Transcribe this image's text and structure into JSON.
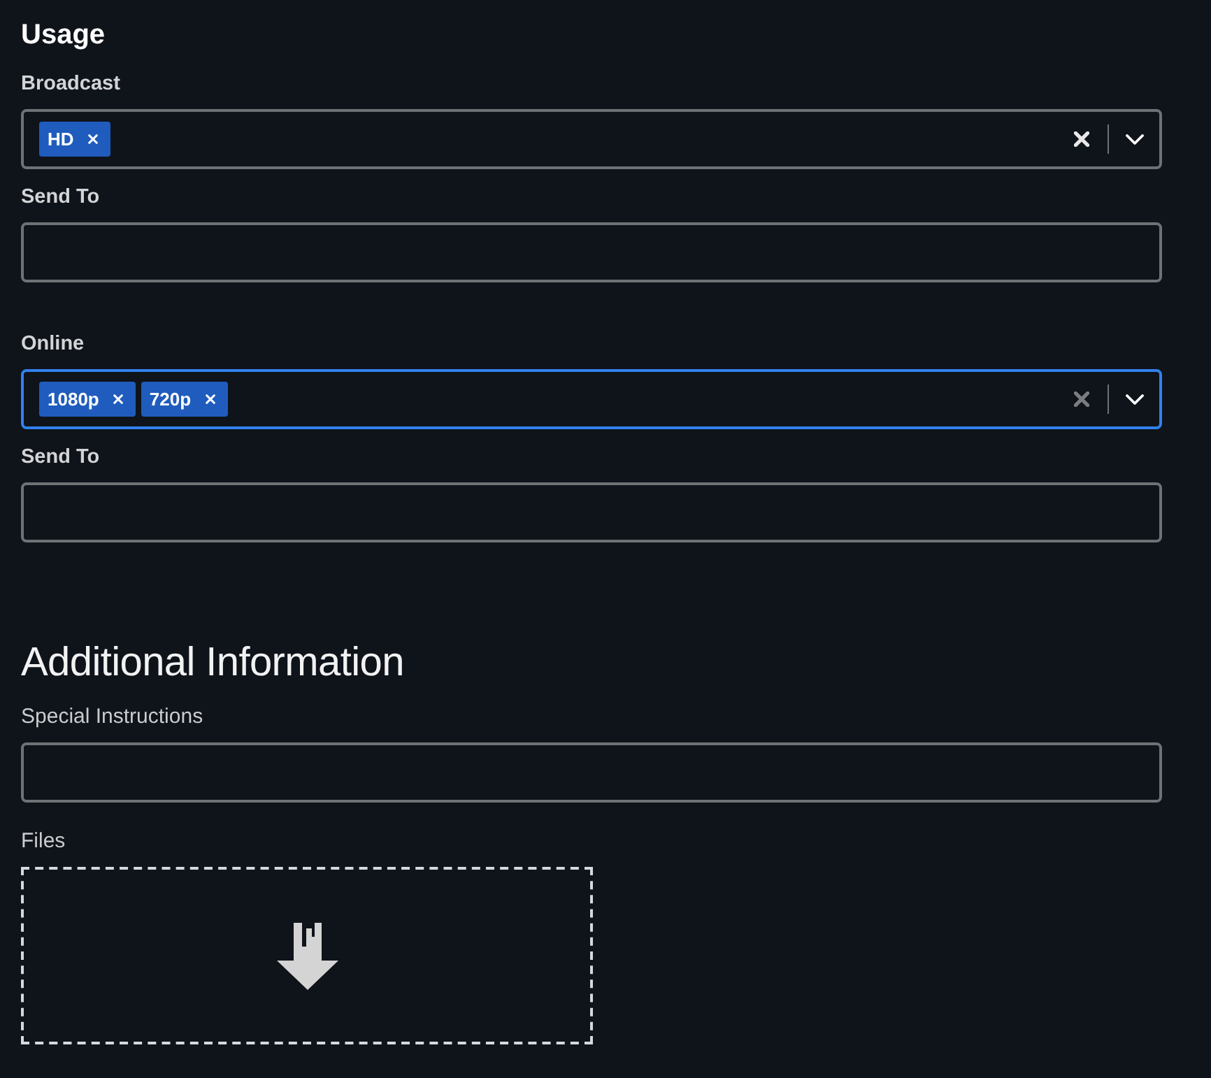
{
  "usage": {
    "title": "Usage",
    "groups": [
      {
        "label": "Broadcast",
        "select": {
          "focused": false,
          "tags": [
            "HD"
          ]
        },
        "send_to": {
          "label": "Send To"
        }
      },
      {
        "label": "Online",
        "select": {
          "focused": true,
          "tags": [
            "1080p",
            "720p"
          ]
        },
        "send_to": {
          "label": "Send To"
        }
      }
    ]
  },
  "additional_information": {
    "title": "Additional Information",
    "fields": [
      {
        "kind": "text",
        "label": "Special Instructions"
      },
      {
        "kind": "file_drop",
        "label": "Files"
      }
    ]
  }
}
